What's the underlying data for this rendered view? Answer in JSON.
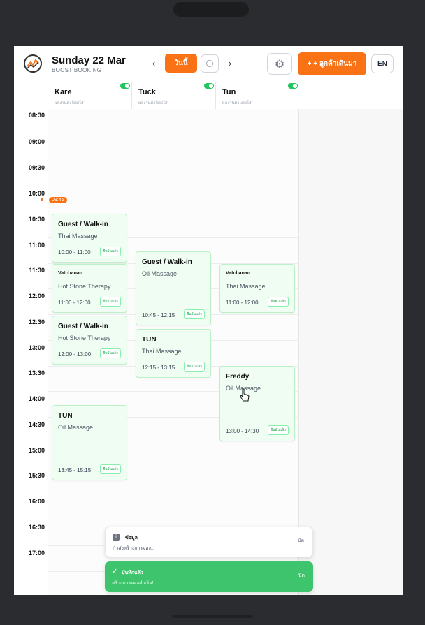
{
  "header": {
    "title": "Sunday 22 Mar",
    "subtitle": "BOOST BOOKING",
    "prev": "‹",
    "next": "›",
    "today_label": "วันนี้",
    "settings_icon": "⚙",
    "add_label": "+ + ลูกค้าเดินมา",
    "lang_label": "EN"
  },
  "staff": [
    {
      "name": "Kare",
      "sub": "ผลงานยังไม่มีใส่"
    },
    {
      "name": "Tuck",
      "sub": "ผลงานยังไม่มีใส่"
    },
    {
      "name": "Tun",
      "sub": "ผลงานยังไม่มีใส่"
    }
  ],
  "times": [
    "08:30",
    "09:00",
    "09:30",
    "10:00",
    "10:30",
    "11:00",
    "11:30",
    "12:00",
    "12:30",
    "13:00",
    "13:30",
    "14:00",
    "14:30",
    "15:00",
    "15:30",
    "16:00",
    "16:30",
    "17:00"
  ],
  "now_label": "09:46",
  "bookings": [
    {
      "name": "Guest / Walk-in",
      "type": "Thai Massage",
      "time": "10:00 - 11:00",
      "status": "ยืนยันแล้ว",
      "small": false
    },
    {
      "name": "Vatchanan",
      "type": "Hot Stone Therapy",
      "time": "11:00 - 12:00",
      "status": "ยืนยันแล้ว",
      "small": true
    },
    {
      "name": "Guest / Walk-in",
      "type": "Hot Stone Therapy",
      "time": "12:00 - 13:00",
      "status": "ยืนยันแล้ว",
      "small": false
    },
    {
      "name": "TUN",
      "type": "Oil Massage",
      "time": "13:45 - 15:15",
      "status": "ยืนยันแล้ว",
      "small": false
    },
    {
      "name": "Guest / Walk-in",
      "type": "Oil Massage",
      "time": "10:45 - 12:15",
      "status": "ยืนยันแล้ว",
      "small": false
    },
    {
      "name": "TUN",
      "type": "Thai Massage",
      "time": "12:15 - 13:15",
      "status": "ยืนยันแล้ว",
      "small": false
    },
    {
      "name": "Vatchanan",
      "type": "Thai Massage",
      "time": "11:00 - 12:00",
      "status": "ยืนยันแล้ว",
      "small": true
    },
    {
      "name": "Freddy",
      "type": "Oil Massage",
      "time": "13:00 - 14:30",
      "status": "ยืนยันแล้ว",
      "small": false
    }
  ],
  "toasts": {
    "info": {
      "icon": "i",
      "title": "ข้อมูล",
      "message": "กำลังสร้างการจอง...",
      "close": "ปิด"
    },
    "success": {
      "icon": "✓",
      "title": "บันทึกแล้ว",
      "message": "สร้างการจองสำเร็จ!",
      "close": "ปิด"
    }
  },
  "colors": {
    "accent": "#f97316",
    "card_bg": "#f0fdf2",
    "success": "#3ec46d"
  }
}
